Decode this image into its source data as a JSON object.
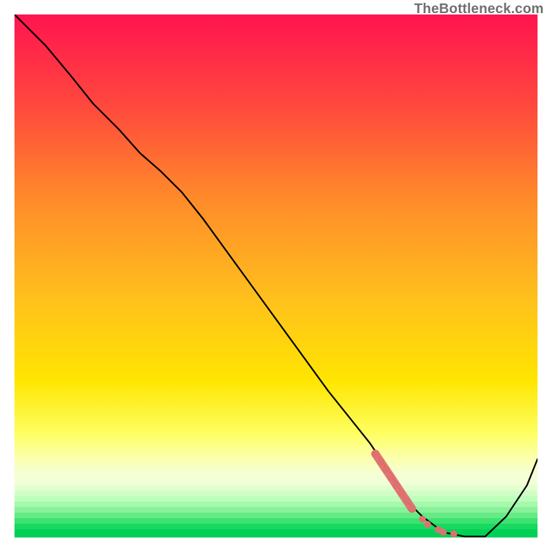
{
  "watermark": "TheBottleneck.com",
  "colors": {
    "top": "#ff1450",
    "orange": "#ff8a2a",
    "yellow": "#ffe500",
    "lightyellow": "#fcffb4",
    "paleband": "#d9ffcf",
    "green": "#00e05a",
    "line": "#000000",
    "marker": "#e07070"
  },
  "chart_data": {
    "type": "line",
    "title": "",
    "xlabel": "",
    "ylabel": "",
    "xlim": [
      0,
      100
    ],
    "ylim": [
      0,
      100
    ],
    "grid": false,
    "series": [
      {
        "name": "curve",
        "x": [
          0,
          6,
          11,
          15,
          20,
          24,
          28,
          32,
          36,
          40,
          44,
          48,
          52,
          56,
          60,
          64,
          68,
          72,
          75,
          78,
          82,
          86,
          90,
          94,
          98,
          100
        ],
        "y": [
          100,
          94,
          88,
          83,
          78,
          73.5,
          70,
          66,
          61,
          55.5,
          50,
          44.5,
          39,
          33.5,
          28,
          23,
          18,
          12,
          7,
          4,
          1,
          0.2,
          0.2,
          4,
          10,
          15
        ]
      }
    ],
    "markers": {
      "name": "highlight",
      "x": [
        69,
        70,
        71,
        72,
        73,
        74,
        75,
        76,
        78,
        79,
        81,
        82,
        84
      ],
      "y": [
        16,
        14.5,
        13,
        11.5,
        10,
        8.5,
        7,
        5.5,
        3.5,
        2.5,
        1.5,
        1,
        0.7
      ]
    }
  }
}
